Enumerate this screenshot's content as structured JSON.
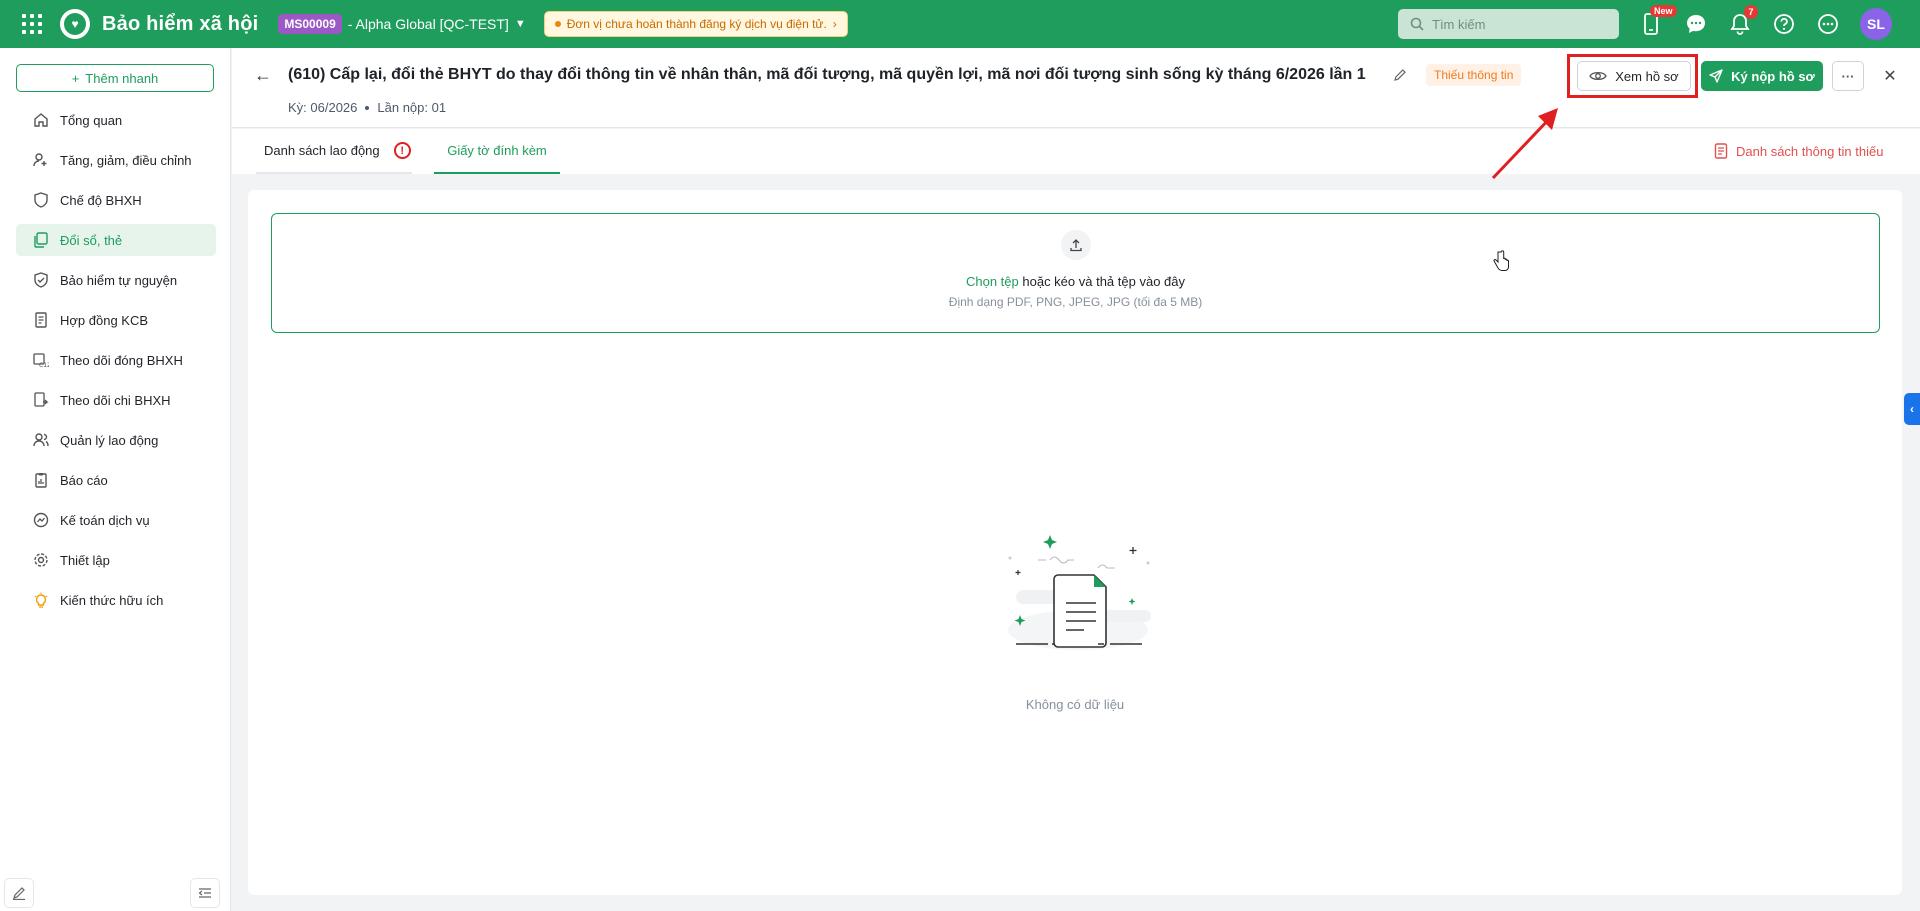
{
  "topbar": {
    "app_title": "Bảo hiểm xã hội",
    "org_code": "MS00009",
    "org_name": "- Alpha Global [QC-TEST]",
    "alert": "Đơn vị chưa hoàn thành đăng ký dịch vụ điện tử.",
    "search_placeholder": "Tìm kiếm",
    "new_badge": "New",
    "notification_count": "7",
    "avatar": "SL",
    "icons": [
      "apps-grid-icon",
      "mobile-icon",
      "chat-icon",
      "bell-icon",
      "help-icon",
      "more-icon"
    ]
  },
  "sidebar": {
    "quick_add": "Thêm nhanh",
    "items": [
      {
        "label": "Tổng quan",
        "icon": "home-icon",
        "active": false
      },
      {
        "label": "Tăng, giảm, điều chỉnh",
        "icon": "user-adjust-icon",
        "active": false
      },
      {
        "label": "Chế độ BHXH",
        "icon": "shield-heart-icon",
        "active": false
      },
      {
        "label": "Đổi sổ, thẻ",
        "icon": "copy-card-icon",
        "active": true
      },
      {
        "label": "Bảo hiểm tự nguyện",
        "icon": "shield-icon",
        "active": false
      },
      {
        "label": "Hợp đồng KCB",
        "icon": "contract-icon",
        "active": false
      },
      {
        "label": "Theo dõi đóng BHXH",
        "icon": "c12-icon",
        "active": false
      },
      {
        "label": "Theo dõi chi BHXH",
        "icon": "payout-icon",
        "active": false
      },
      {
        "label": "Quản lý lao động",
        "icon": "users-icon",
        "active": false
      },
      {
        "label": "Báo cáo",
        "icon": "report-icon",
        "active": false
      },
      {
        "label": "Kế toán dịch vụ",
        "icon": "accounting-icon",
        "active": false
      },
      {
        "label": "Thiết lập",
        "icon": "gear-icon",
        "active": false
      },
      {
        "label": "Kiến thức hữu ích",
        "icon": "bulb-icon",
        "active": false
      }
    ]
  },
  "header": {
    "title": "(610) Cấp lại, đổi thẻ BHYT do thay đổi thông tin về nhân thân, mã đối tượng, mã quyền lợi, mã nơi đối tượng sinh sống kỳ tháng 6/2026 lần 1",
    "status": "Thiếu thông tin",
    "period": "Kỳ: 06/2026",
    "submission": "Lần nộp: 01",
    "view_button": "Xem hồ sơ",
    "submit_button": "Ký nộp hồ sơ"
  },
  "tabs": {
    "labor_list": "Danh sách lao động",
    "attachments": "Giấy tờ đính kèm",
    "missing_info": "Danh sách thông tin thiếu"
  },
  "upload": {
    "choose_file": "Chọn tệp",
    "drag_text": "hoặc kéo và thả tệp vào đây",
    "formats": "Định dạng PDF, PNG, JPEG, JPG (tối đa 5 MB)"
  },
  "empty": {
    "text": "Không có dữ liệu"
  },
  "colors": {
    "brand": "#1f9d5c",
    "org_badge": "#9b59c6",
    "warning": "#f07b1d",
    "error": "#e02020",
    "avatar": "#8a63e8"
  }
}
